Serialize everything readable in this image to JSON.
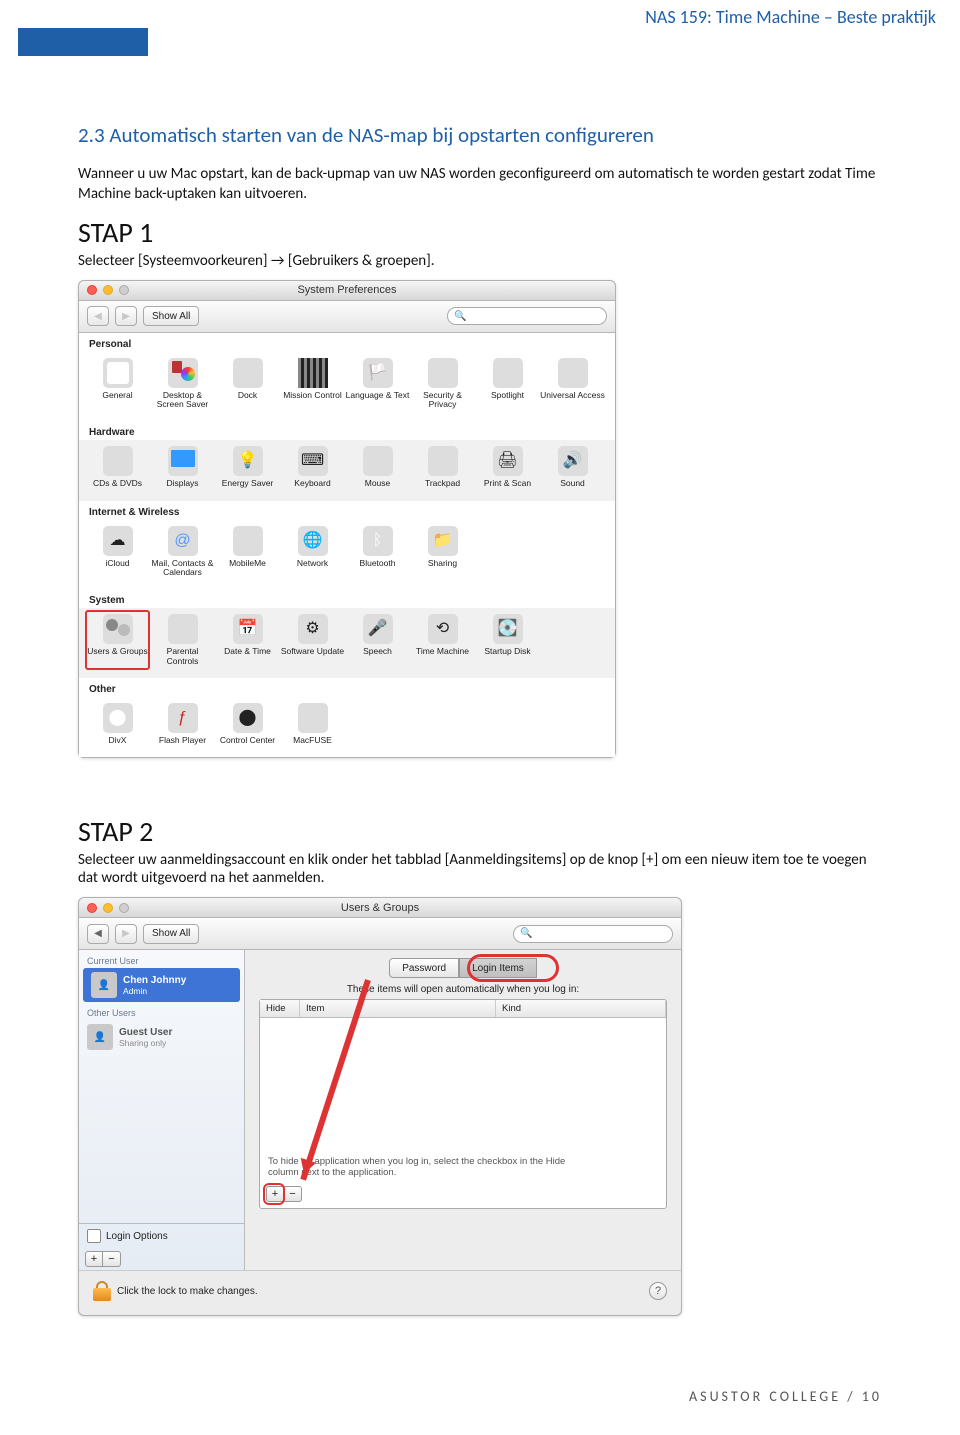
{
  "header": {
    "title": "NAS 159: Time Machine – Beste praktijk"
  },
  "section": {
    "heading": "2.3 Automatisch starten van de NAS-map bij opstarten configureren",
    "paragraph": "Wanneer u uw Mac opstart, kan de back-upmap van uw NAS worden geconfigureerd om automatisch te worden gestart zodat Time Machine back-uptaken kan uitvoeren."
  },
  "step1": {
    "title": "STAP 1",
    "body": "Selecteer [Systeemvoorkeuren] → [Gebruikers & groepen]."
  },
  "syspref": {
    "window_title": "System Preferences",
    "show_all": "Show All",
    "search_placeholder": "",
    "sections": {
      "personal": "Personal",
      "hardware": "Hardware",
      "internet": "Internet & Wireless",
      "system": "System",
      "other": "Other"
    },
    "items": {
      "general": "General",
      "desktop": "Desktop & Screen Saver",
      "dock": "Dock",
      "mission": "Mission Control",
      "language": "Language & Text",
      "security": "Security & Privacy",
      "spotlight": "Spotlight",
      "universal": "Universal Access",
      "cds": "CDs & DVDs",
      "displays": "Displays",
      "energy": "Energy Saver",
      "keyboard": "Keyboard",
      "mouse": "Mouse",
      "trackpad": "Trackpad",
      "print": "Print & Scan",
      "sound": "Sound",
      "icloud": "iCloud",
      "mail": "Mail, Contacts & Calendars",
      "mobileme": "MobileMe",
      "network": "Network",
      "bluetooth": "Bluetooth",
      "sharing": "Sharing",
      "users": "Users & Groups",
      "parental": "Parental Controls",
      "date": "Date & Time",
      "software": "Software Update",
      "speech": "Speech",
      "timemachine": "Time Machine",
      "startup": "Startup Disk",
      "divx": "DivX",
      "flash": "Flash Player",
      "controlcenter": "Control Center",
      "macfuse": "MacFUSE"
    }
  },
  "step2": {
    "title": "STAP 2",
    "body": "Selecteer uw aanmeldingsaccount en klik onder het tabblad [Aanmeldingsitems] op de knop [+] om een nieuw item toe te voegen dat wordt uitgevoerd na het aanmelden."
  },
  "usersgroups": {
    "window_title": "Users & Groups",
    "show_all": "Show All",
    "sidebar": {
      "current_user": "Current User",
      "other_users": "Other Users",
      "user_name": "Chen Johnny",
      "user_role": "Admin",
      "guest_name": "Guest User",
      "guest_role": "Sharing only",
      "login_options": "Login Options"
    },
    "tabs": {
      "password": "Password",
      "login_items": "Login Items"
    },
    "hint": "These items will open automatically when you log in:",
    "columns": {
      "hide": "Hide",
      "item": "Item",
      "kind": "Kind"
    },
    "note_line1": "To hide an application when you log in, select the checkbox in the Hide",
    "note_line2": "column next to the application.",
    "lock_text": "Click the lock to make changes."
  },
  "footer": {
    "text": "ASUSTOR COLLEGE / 10"
  }
}
